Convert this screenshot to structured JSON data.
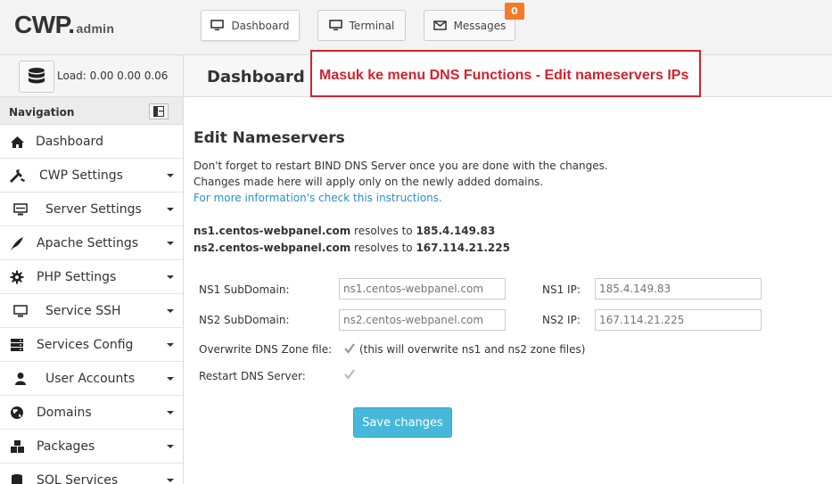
{
  "header": {
    "logo_main": "CWP.",
    "logo_sub": "admin",
    "buttons": [
      {
        "label": "Dashboard"
      },
      {
        "label": "Terminal"
      },
      {
        "label": "Messages",
        "badge": "0"
      }
    ]
  },
  "load": {
    "text": "Load: 0.00  0.00  0.06"
  },
  "page_title": "Dashboard",
  "annotation": "Masuk ke menu DNS Functions - Edit nameservers IPs",
  "sidebar": {
    "heading": "Navigation",
    "items": [
      {
        "label": "Dashboard",
        "icon": "home-icon"
      },
      {
        "label": "CWP Settings",
        "icon": "tools-icon"
      },
      {
        "label": "Server Settings",
        "icon": "server-icon"
      },
      {
        "label": "Apache Settings",
        "icon": "feather-icon"
      },
      {
        "label": "PHP Settings",
        "icon": "gear-icon"
      },
      {
        "label": "Service SSH",
        "icon": "monitor-icon"
      },
      {
        "label": "Services Config",
        "icon": "server-stack-icon"
      },
      {
        "label": "User Accounts",
        "icon": "user-icon"
      },
      {
        "label": "Domains",
        "icon": "globe-icon"
      },
      {
        "label": "Packages",
        "icon": "cubes-icon"
      },
      {
        "label": "SQL Services",
        "icon": "database-icon"
      }
    ]
  },
  "main": {
    "title": "Edit Nameservers",
    "line1": "Don't forget to restart BIND DNS Server once you are done with the changes.",
    "line2": "Changes made here will apply only on the newly added domains.",
    "link": "For more information's check this instructions.",
    "ns1": {
      "host": "ns1.centos-webpanel.com",
      "text": " resolves to ",
      "ip": "185.4.149.83"
    },
    "ns2": {
      "host": "ns2.centos-webpanel.com",
      "text": " resolves to ",
      "ip": "167.114.21.225"
    },
    "form": {
      "ns1_sub_label": "NS1 SubDomain:",
      "ns1_sub_value": "ns1.centos-webpanel.com",
      "ns1_ip_label": "NS1 IP:",
      "ns1_ip_value": "185.4.149.83",
      "ns2_sub_label": "NS2 SubDomain:",
      "ns2_sub_value": "ns2.centos-webpanel.com",
      "ns2_ip_label": "NS2 IP:",
      "ns2_ip_value": "167.114.21.225",
      "overwrite_label": "Overwrite DNS Zone file:",
      "overwrite_note": "(this will overwrite ns1 and ns2 zone files)",
      "restart_label": "Restart DNS Server:",
      "save_label": "Save changes"
    }
  },
  "colors": {
    "accent": "#46b8da",
    "annotation": "#d2222d",
    "badge": "#f47a28",
    "link": "#2a8ecf"
  }
}
